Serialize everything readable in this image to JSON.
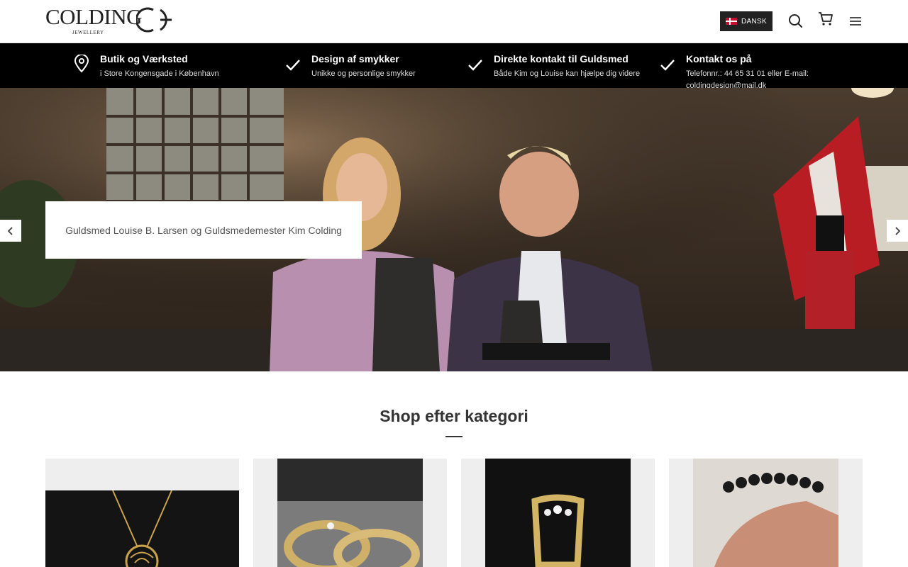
{
  "header": {
    "logo": {
      "word": "COLDING",
      "sub": "JEWELLERY",
      "monogram": "CG"
    },
    "language_label": "DANSK",
    "icons": [
      "search-icon",
      "cart-icon",
      "menu-icon"
    ]
  },
  "infobar": {
    "items": [
      {
        "icon": "location-pin-icon",
        "title": "Butik og Værksted",
        "subtitle": "i Store Kongensgade i København"
      },
      {
        "icon": "check-icon",
        "title": "Design af smykker",
        "subtitle": "Unikke og personlige smykker"
      },
      {
        "icon": "check-icon",
        "title": "Direkte kontakt til Guldsmed",
        "subtitle": "Både Kim og Louise kan hjælpe dig videre"
      },
      {
        "icon": "check-icon",
        "title": "Kontakt os på",
        "subtitle": "Telefonnr.: 44 65 31 01 eller E-mail: coldingdesign@mail.dk"
      }
    ]
  },
  "hero": {
    "caption": "Guldsmed Louise B. Larsen og Guldsmedemester Kim Colding"
  },
  "categories": {
    "title": "Shop efter kategori"
  },
  "colors": {
    "infobar_bg": "#000000",
    "flag_red": "#c8102e",
    "text_dark": "#333333",
    "card_bg": "#eeeeee"
  }
}
